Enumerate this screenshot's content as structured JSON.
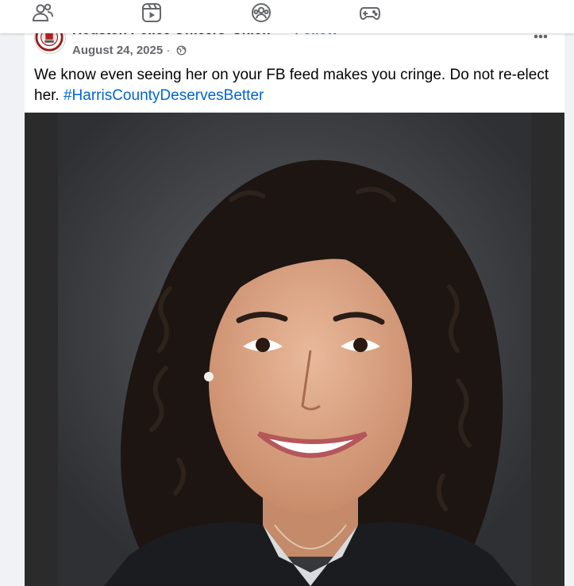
{
  "nav": {
    "icons": [
      "friends-icon",
      "reels-video-icon",
      "groups-icon",
      "gaming-icon"
    ]
  },
  "post": {
    "page_name": "Houston Police Officers' Union",
    "follow_separator": "·",
    "follow_label": "Follow",
    "date": "August 24, 2025",
    "meta_separator": "·",
    "privacy_icon": "globe-icon",
    "more_icon": "more-options-icon",
    "text": "We know even seeing her on your FB feed makes you cringe. Do not re-elect her.",
    "hashtag": "#HarrisCountyDeservesBetter"
  },
  "colors": {
    "accent": "#0866ff",
    "hashtag": "#0064d1",
    "secondary_text": "#65676b",
    "background": "#f0f2f5"
  }
}
